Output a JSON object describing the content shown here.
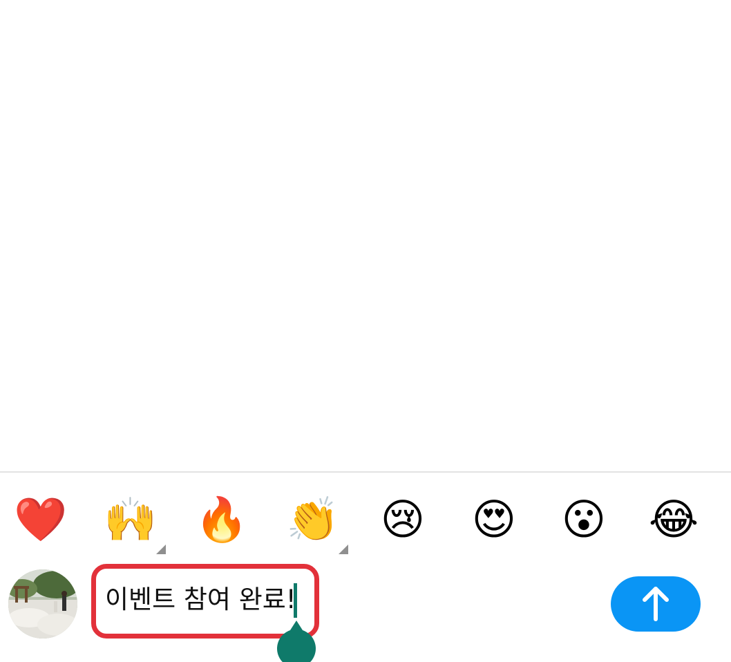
{
  "reactions": [
    {
      "emoji": "❤️",
      "name": "heart"
    },
    {
      "emoji": "🙌",
      "name": "raising-hands"
    },
    {
      "emoji": "🔥",
      "name": "fire"
    },
    {
      "emoji": "👏",
      "name": "clapping-hands"
    },
    {
      "emoji": "😢",
      "name": "crying-face"
    },
    {
      "emoji": "😍",
      "name": "heart-eyes"
    },
    {
      "emoji": "😮",
      "name": "surprised-face"
    },
    {
      "emoji": "😂",
      "name": "tears-of-joy"
    }
  ],
  "composer": {
    "input_value": "이벤트 참여 완료!",
    "send_icon": "arrow-up-icon"
  },
  "colors": {
    "send_button": "#0a95f5",
    "annotation_outline": "#e2313a",
    "caret": "#0f7a6a",
    "divider": "#e2e2e2"
  }
}
